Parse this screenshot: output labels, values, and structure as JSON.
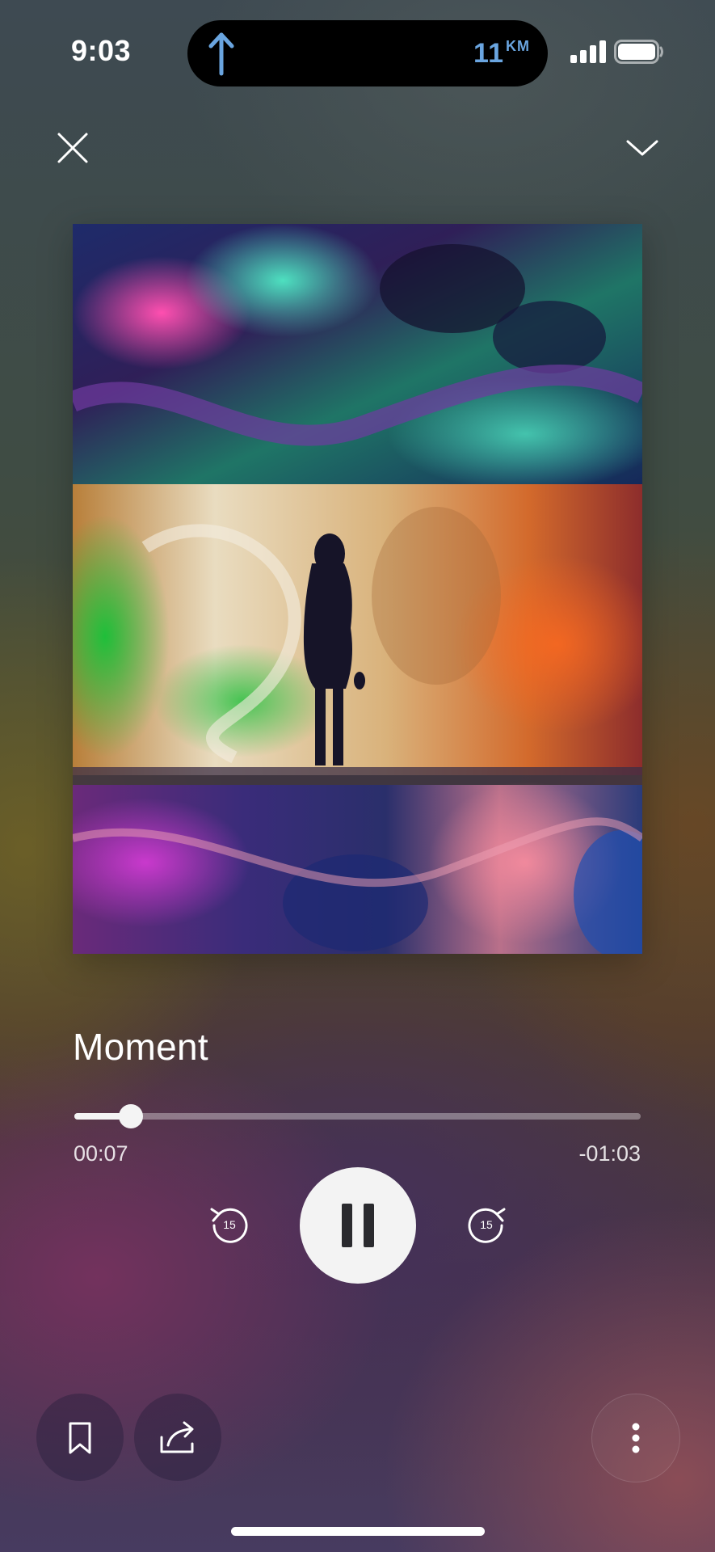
{
  "status_bar": {
    "time": "9:03",
    "navigation_distance": "11",
    "navigation_unit": "KM",
    "navigation_icon": "arrow-up-icon",
    "signal_icon": "cellular-signal-icon",
    "battery_icon": "battery-icon"
  },
  "header": {
    "close_icon": "close-icon",
    "collapse_icon": "chevron-down-icon"
  },
  "now_playing": {
    "title": "Moment",
    "elapsed": "00:07",
    "remaining": "-01:03",
    "progress_fraction": 0.1
  },
  "controls": {
    "rewind_seconds": "15",
    "forward_seconds": "15",
    "play_state_icon": "pause-icon"
  },
  "bottom_bar": {
    "bookmark_icon": "bookmark-icon",
    "share_icon": "share-icon",
    "more_icon": "more-vertical-icon"
  },
  "colors": {
    "nav_blue": "#6aa5e0",
    "control_white": "#f3f3f3"
  }
}
